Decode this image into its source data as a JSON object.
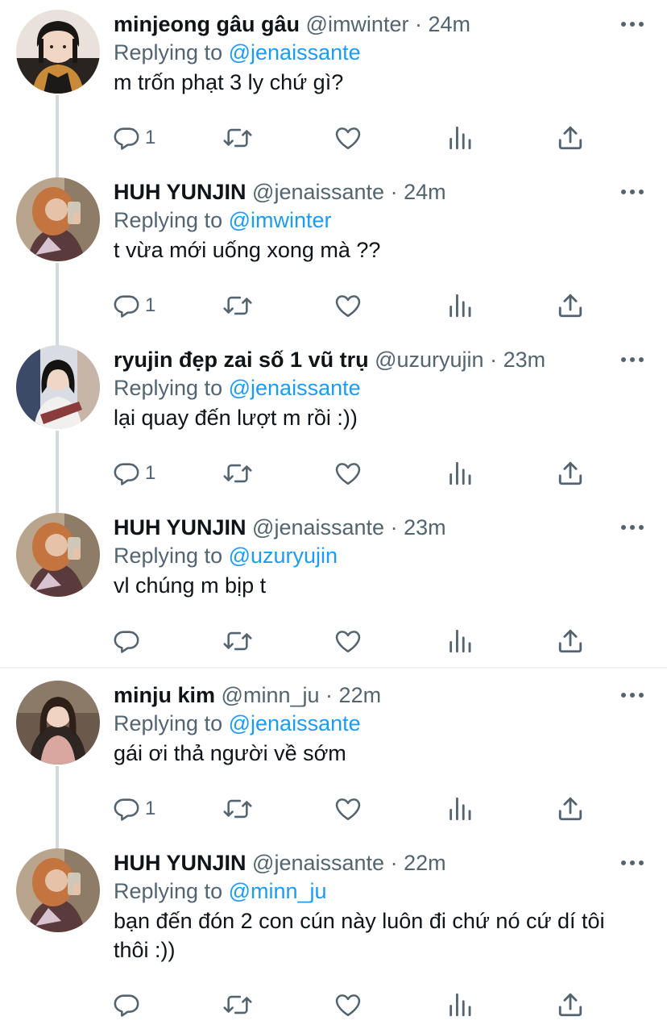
{
  "colors": {
    "accent": "#1d9bf0",
    "secondary_text": "#536471",
    "primary_text": "#0f1419",
    "thread_line": "#cfd9de"
  },
  "tweets": [
    {
      "name": "minjeong gâu gâu",
      "handle": "@imwinter",
      "dot": "·",
      "time": "24m",
      "replying_prefix": "Replying to",
      "replying_to": "@jenaissante",
      "text": "m trốn phạt 3 ly chứ gì?",
      "reply_count": "1",
      "avatar": "avatar-minjeong",
      "thread_continues": true
    },
    {
      "name": "HUH YUNJIN",
      "handle": "@jenaissante",
      "dot": "·",
      "time": "24m",
      "replying_prefix": "Replying to",
      "replying_to": "@imwinter",
      "text": "t vừa mới uống xong mà ??",
      "reply_count": "1",
      "avatar": "avatar-yunjin",
      "thread_continues": true
    },
    {
      "name": "ryujin đẹp zai số 1 vũ trụ",
      "handle": "@uzuryujin",
      "dot": "·",
      "time": "23m",
      "replying_prefix": "Replying to",
      "replying_to": "@jenaissante",
      "text": "lại quay đến lượt m rồi :))",
      "reply_count": "1",
      "avatar": "avatar-ryujin",
      "thread_continues": true
    },
    {
      "name": "HUH YUNJIN",
      "handle": "@jenaissante",
      "dot": "·",
      "time": "23m",
      "replying_prefix": "Replying to",
      "replying_to": "@uzuryujin",
      "text": "vl chúng m bịp t",
      "reply_count": "",
      "avatar": "avatar-yunjin",
      "thread_continues": false
    },
    {
      "name": "minju kim",
      "handle": "@minn_ju",
      "dot": "·",
      "time": "22m",
      "replying_prefix": "Replying to",
      "replying_to": "@jenaissante",
      "text": "gái ơi thả người về sớm",
      "reply_count": "1",
      "avatar": "avatar-minju",
      "thread_continues": true
    },
    {
      "name": "HUH YUNJIN",
      "handle": "@jenaissante",
      "dot": "·",
      "time": "22m",
      "replying_prefix": "Replying to",
      "replying_to": "@minn_ju",
      "text": "bạn đến đón 2 con cún này luôn đi chứ nó cứ dí tôi thôi :))",
      "reply_count": "",
      "avatar": "avatar-yunjin",
      "thread_continues": false
    }
  ]
}
